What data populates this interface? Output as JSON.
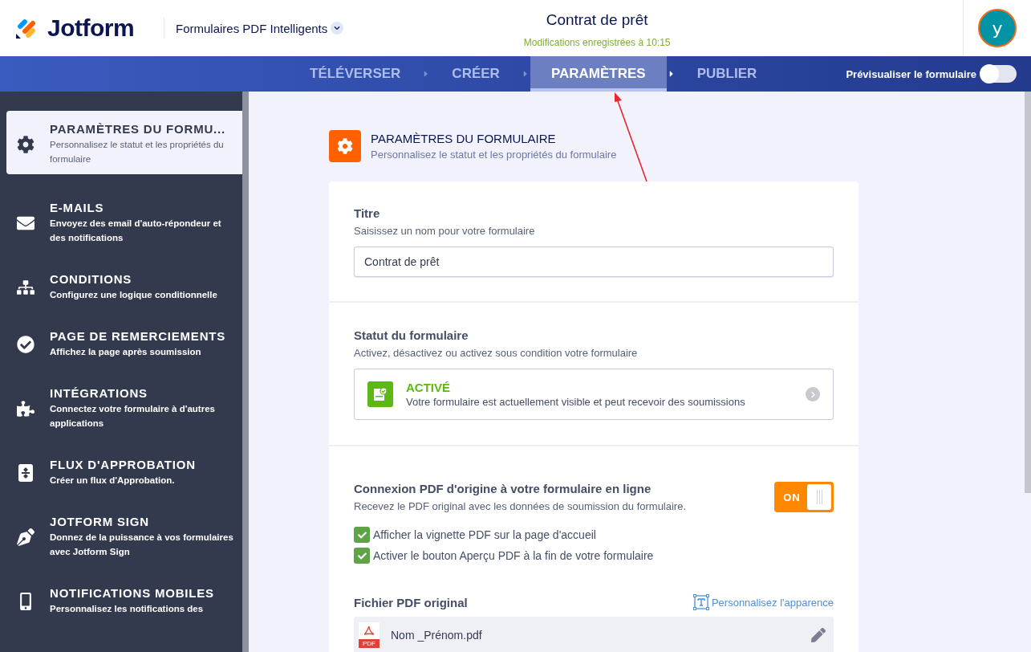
{
  "header": {
    "logo": "Jotform",
    "form_type": "Formulaires PDF Intelligents",
    "title": "Contrat de prêt",
    "save_status": "Modifications enregistrées à 10:15",
    "avatar": "y"
  },
  "nav": {
    "tabs": [
      {
        "label": "TÉLÉVERSER",
        "selected": false
      },
      {
        "label": "CRÉER",
        "selected": false
      },
      {
        "label": "PARAMÈTRES",
        "selected": true
      },
      {
        "label": "PUBLIER",
        "selected": false
      }
    ],
    "preview": {
      "label": "Prévisualiser le formulaire",
      "on": false
    }
  },
  "sidebar": {
    "items": [
      {
        "kind": "gear",
        "title": "PARAMÈTRES DU FORMU...",
        "description": "Personnalisez le statut et les propriétés du formulaire",
        "selected": true
      },
      {
        "kind": "email",
        "title": "E-MAILS",
        "description": "Envoyez des email d'auto-répondeur et des notifications",
        "selected": false
      },
      {
        "kind": "conditions",
        "title": "CONDITIONS",
        "description": "Configurez une logique conditionnelle",
        "selected": false
      },
      {
        "kind": "thankyou",
        "title": "PAGE DE REMERCIEMENTS",
        "description": "Affichez la page après soumission",
        "selected": false
      },
      {
        "kind": "integrations",
        "title": "INTÉGRATIONS",
        "description": "Connectez votre formulaire à d'autres applications",
        "selected": false
      },
      {
        "kind": "approval",
        "title": "FLUX D'APPROBATION",
        "description": "Créer un flux d'Approbation.",
        "selected": false
      },
      {
        "kind": "sign",
        "title": "JOTFORM SIGN",
        "description": "Donnez de la puissance à vos formulaires avec Jotform Sign",
        "selected": false
      },
      {
        "kind": "mobile",
        "title": "NOTIFICATIONS MOBILES",
        "description": "Personnalisez les notifications des",
        "selected": false
      }
    ]
  },
  "section": {
    "title": "PARAMÈTRES DU FORMULAIRE",
    "subtitle": "Personnalisez le statut et les propriétés du formulaire"
  },
  "title_field": {
    "label": "Titre",
    "hint": "Saisissez un nom pour votre formulaire",
    "value": "Contrat de prêt"
  },
  "status": {
    "label": "Statut du formulaire",
    "hint": "Activez, désactivez ou activez sous condition votre formulaire",
    "state": "ACTIVÉ",
    "description": "Votre formulaire est actuellement visible et peut recevoir des soumissions"
  },
  "pdf_connection": {
    "label": "Connexion PDF d'origine à votre formulaire en ligne",
    "hint": "Recevez le PDF original avec les données de soumission du formulaire.",
    "toggle": {
      "label": "ON",
      "on": true
    },
    "options": [
      {
        "label": "Afficher la vignette PDF sur la page d'accueil",
        "checked": true
      },
      {
        "label": "Activer le bouton Aperçu PDF à la fin de votre formulaire",
        "checked": true
      }
    ]
  },
  "pdf_file": {
    "label": "Fichier PDF original",
    "customize_link": "Personnalisez l'apparence",
    "file_badge": "PDF",
    "file_name": "Nom _Prénom.pdf"
  }
}
